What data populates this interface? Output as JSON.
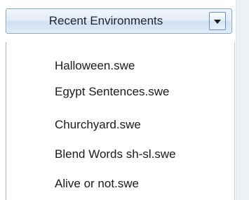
{
  "combo": {
    "selected_label": "Recent Environments",
    "dropdown_icon": "chevron-down-icon"
  },
  "dropdown": {
    "items": [
      {
        "label": "Halloween.swe"
      },
      {
        "label": "Egypt Sentences.swe"
      },
      {
        "label": "Churchyard.swe"
      },
      {
        "label": "Blend Words sh-sl.swe"
      },
      {
        "label": "Alive or not.swe"
      }
    ]
  },
  "colors": {
    "combo_border": "#7ea1c5",
    "combo_fill_top": "#f1f7fd",
    "combo_fill_bottom": "#cfe0f2",
    "menu_background": "#ffffff",
    "text": "#1a1a1a"
  }
}
